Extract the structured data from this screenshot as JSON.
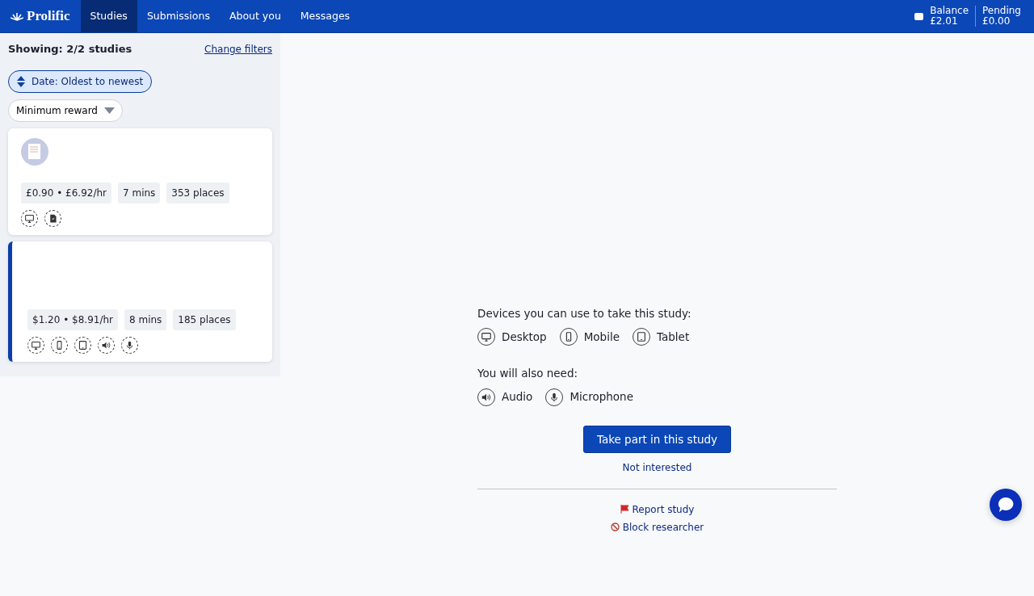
{
  "navbar": {
    "brand": "Prolific",
    "items": [
      {
        "label": "Studies",
        "selected": true
      },
      {
        "label": "Submissions",
        "selected": false
      },
      {
        "label": "About you",
        "selected": false
      },
      {
        "label": "Messages",
        "selected": false
      }
    ],
    "balance": {
      "label": "Balance",
      "value": "£2.01"
    },
    "pending": {
      "label": "Pending",
      "value": "£0.00"
    }
  },
  "sidebar": {
    "showing": "Showing: 2/2 studies",
    "change_filters": "Change filters",
    "sort": {
      "label": "Date: Oldest to newest"
    },
    "filter": {
      "label": "Minimum reward"
    },
    "studies": [
      {
        "selected": false,
        "has_avatar": true,
        "reward": "£0.90 • £6.92/hr",
        "duration": "7 mins",
        "places": "353 places",
        "requirements": [
          {
            "kind": "desktop"
          },
          {
            "kind": "document"
          }
        ]
      },
      {
        "selected": true,
        "has_avatar": false,
        "reward": "$1.20 • $8.91/hr",
        "duration": "8 mins",
        "places": "185 places",
        "requirements": [
          {
            "kind": "desktop"
          },
          {
            "kind": "mobile"
          },
          {
            "kind": "tablet"
          },
          {
            "kind": "audio"
          },
          {
            "kind": "microphone"
          }
        ]
      }
    ]
  },
  "detail": {
    "devices_heading": "Devices you can use to take this study:",
    "devices": [
      {
        "kind": "desktop",
        "label": "Desktop"
      },
      {
        "kind": "mobile",
        "label": "Mobile"
      },
      {
        "kind": "tablet",
        "label": "Tablet"
      }
    ],
    "also_need_heading": "You will also need:",
    "also_need": [
      {
        "kind": "audio",
        "label": "Audio"
      },
      {
        "kind": "microphone",
        "label": "Microphone"
      }
    ],
    "primary_button": "Take part in this study",
    "not_interested": "Not interested",
    "report": "Report study",
    "block": "Block researcher"
  }
}
